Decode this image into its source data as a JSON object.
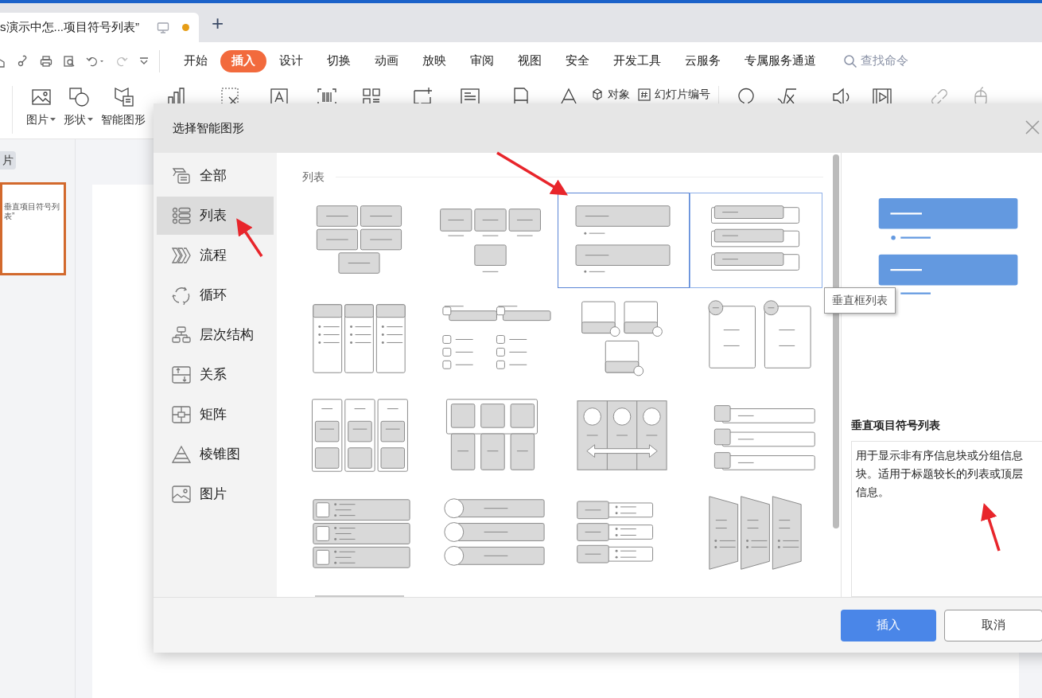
{
  "document_tab": {
    "title": "s演示中怎...项目符号列表”",
    "unsaved": true,
    "new_tab": "+"
  },
  "menu_tabs": [
    {
      "label": "开始",
      "selected": false
    },
    {
      "label": "插入",
      "selected": true
    },
    {
      "label": "设计",
      "selected": false
    },
    {
      "label": "切换",
      "selected": false
    },
    {
      "label": "动画",
      "selected": false
    },
    {
      "label": "放映",
      "selected": false
    },
    {
      "label": "审阅",
      "selected": false
    },
    {
      "label": "视图",
      "selected": false
    },
    {
      "label": "安全",
      "selected": false
    },
    {
      "label": "开发工具",
      "selected": false
    },
    {
      "label": "云服务",
      "selected": false
    },
    {
      "label": "专属服务通道",
      "selected": false
    }
  ],
  "search": {
    "placeholder": "查找命令"
  },
  "toolbar": {
    "labels": [
      "图片",
      "形状",
      "智能图形"
    ],
    "inline_buttons": [
      "对象",
      "幻灯片编号"
    ]
  },
  "slide_panel": {
    "tab": "片",
    "thumbnail_text": "垂直项目符号列表”"
  },
  "dialog": {
    "title": "选择智能图形",
    "categories": [
      {
        "label": "全部",
        "selected": false
      },
      {
        "label": "列表",
        "selected": true
      },
      {
        "label": "流程",
        "selected": false
      },
      {
        "label": "循环",
        "selected": false
      },
      {
        "label": "层次结构",
        "selected": false
      },
      {
        "label": "关系",
        "selected": false
      },
      {
        "label": "矩阵",
        "selected": false
      },
      {
        "label": "棱锥图",
        "selected": false
      },
      {
        "label": "图片",
        "selected": false
      }
    ],
    "section": "列表",
    "layouts": [
      {
        "selected": false,
        "hovered": false
      },
      {
        "selected": false,
        "hovered": false
      },
      {
        "selected": true,
        "hovered": false
      },
      {
        "selected": false,
        "hovered": true
      },
      {
        "selected": false,
        "hovered": false
      },
      {
        "selected": false,
        "hovered": false
      },
      {
        "selected": false,
        "hovered": false
      },
      {
        "selected": false,
        "hovered": false
      },
      {
        "selected": false,
        "hovered": false
      },
      {
        "selected": false,
        "hovered": false
      },
      {
        "selected": false,
        "hovered": false
      },
      {
        "selected": false,
        "hovered": false
      },
      {
        "selected": false,
        "hovered": false
      },
      {
        "selected": false,
        "hovered": false
      },
      {
        "selected": false,
        "hovered": false
      },
      {
        "selected": false,
        "hovered": false
      }
    ],
    "tooltip": "垂直框列表",
    "preview": {
      "name": "垂直项目符号列表",
      "description": "用于显示非有序信息块或分组信息块。适用于标题较长的列表或顶层信息。"
    },
    "buttons": [
      {
        "label": "插入",
        "kind": "primary"
      },
      {
        "label": "取消",
        "kind": "secondary"
      }
    ]
  }
}
